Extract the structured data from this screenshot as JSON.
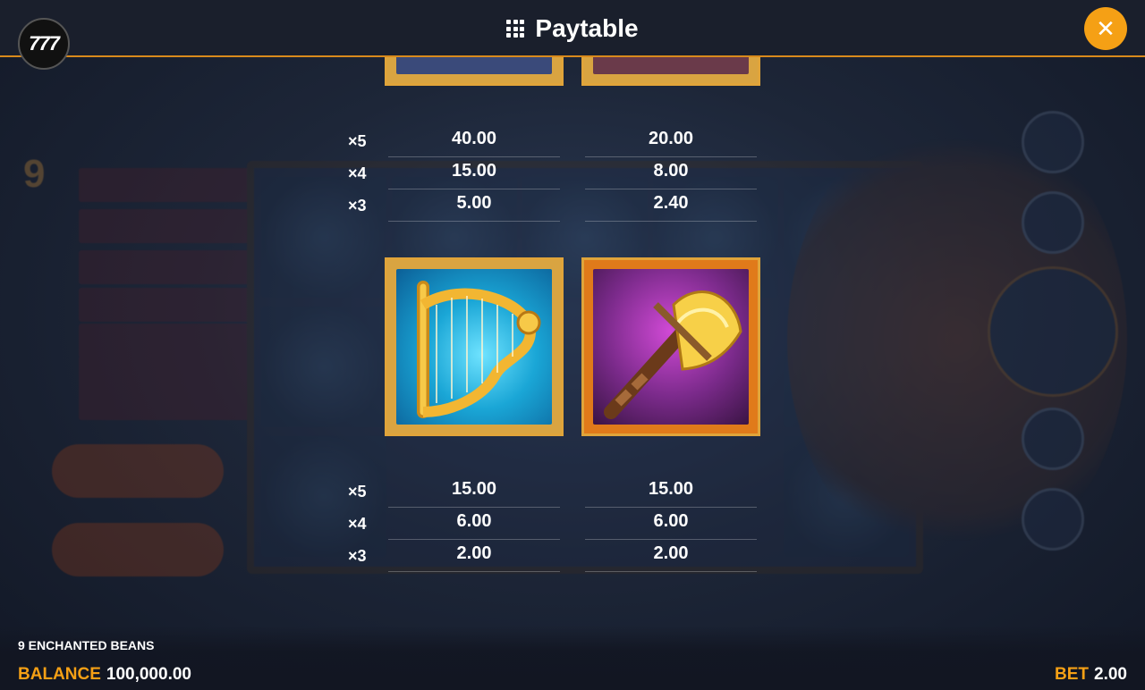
{
  "header": {
    "logo_text": "777",
    "title": "Paytable"
  },
  "paytable": {
    "top_row": {
      "multipliers": [
        "×5",
        "×4",
        "×3"
      ],
      "left_values": [
        "40.00",
        "15.00",
        "5.00"
      ],
      "right_values": [
        "20.00",
        "8.00",
        "2.40"
      ]
    },
    "symbols": [
      {
        "icon": "harp-icon",
        "background": "#1aa6d6"
      },
      {
        "icon": "axe-icon",
        "background": "#7a2a8a"
      }
    ],
    "bottom_row": {
      "multipliers": [
        "×5",
        "×4",
        "×3"
      ],
      "left_values": [
        "15.00",
        "6.00",
        "2.00"
      ],
      "right_values": [
        "15.00",
        "6.00",
        "2.00"
      ]
    }
  },
  "footer": {
    "game_name": "9 ENCHANTED BEANS",
    "balance_label": "BALANCE",
    "balance_value": "100,000.00",
    "bet_label": "BET",
    "bet_value": "2.00"
  },
  "colors": {
    "accent": "#f5a015",
    "frame_gold": "#d9a441"
  }
}
